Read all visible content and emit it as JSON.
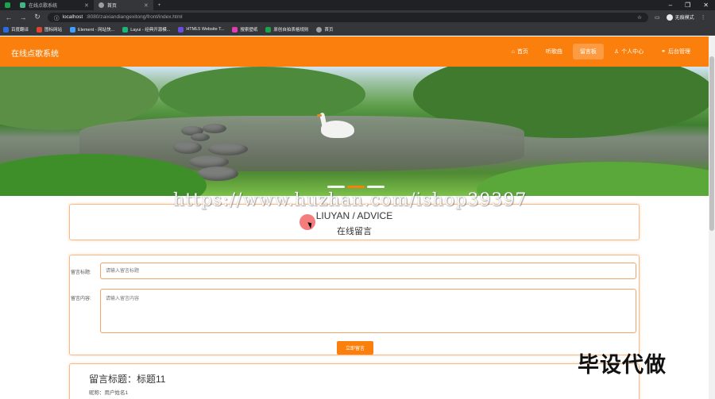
{
  "browser": {
    "tabs": [
      {
        "label": "",
        "active": false
      },
      {
        "label": "在线点歌系统",
        "active": false
      },
      {
        "label": "首页",
        "active": true
      }
    ],
    "new_tab": "+",
    "window_controls": [
      "–",
      "❐",
      "✕"
    ],
    "url_host": "localhost",
    "url_path": ":8080/zaixiandiangexitong/front/index.html",
    "profile_label": "无痕模式",
    "bookmarks": [
      {
        "label": "百度翻译",
        "color": "#2b6de0"
      },
      {
        "label": "图标网站",
        "color": "#e0432b"
      },
      {
        "label": "Element - 网站快...",
        "color": "#409eff"
      },
      {
        "label": "Layui - 经典开源模...",
        "color": "#16b777"
      },
      {
        "label": "HTML5 Website T...",
        "color": "#6a4ce0"
      },
      {
        "label": "搜索壁纸",
        "color": "#e03ab4"
      },
      {
        "label": "原创自拍表格规则",
        "color": "#1aa34a"
      },
      {
        "label": "首页",
        "color": "#9aa0a6"
      }
    ]
  },
  "header": {
    "logo": "在线点歌系统",
    "nav": [
      {
        "label": "首页",
        "icon": "home-icon",
        "glyph": "⌂",
        "active": false
      },
      {
        "label": "听歌曲",
        "icon": "",
        "glyph": "",
        "active": false
      },
      {
        "label": "留言板",
        "icon": "",
        "glyph": "",
        "active": true
      },
      {
        "label": "个人中心",
        "icon": "user-icon",
        "glyph": "♙",
        "active": false
      },
      {
        "label": "后台管理",
        "icon": "link-icon",
        "glyph": "⚭",
        "active": false
      }
    ]
  },
  "banner": {
    "slides": 3,
    "active_slide": 2
  },
  "title_section": {
    "en": "LIUYAN / ADVICE",
    "cn": "在线留言"
  },
  "form": {
    "title_label": "留言标题:",
    "title_placeholder": "请输入留言标题",
    "content_label": "留言内容:",
    "content_placeholder": "请输入留言内容",
    "submit_label": "立即留言"
  },
  "message": {
    "title": "留言标题：标题11",
    "user": "昵称：用户姓名1"
  },
  "overlays": {
    "watermark": "https://www.huzhan.com/ishop39397",
    "stamp": "毕设代做"
  },
  "colors": {
    "accent": "#fb7f0c"
  }
}
